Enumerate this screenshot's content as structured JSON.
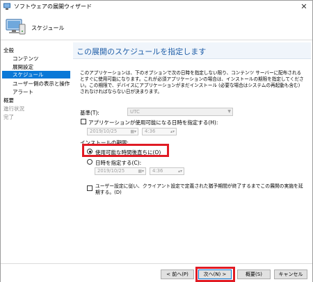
{
  "window": {
    "title": "ソフトウェアの展開ウィザード",
    "close_glyph": "✕"
  },
  "header": {
    "title": "スケジュール"
  },
  "sidebar": {
    "items": [
      {
        "label": "全般",
        "level": 0,
        "state": "normal"
      },
      {
        "label": "コンテンツ",
        "level": 1,
        "state": "normal"
      },
      {
        "label": "展開設定",
        "level": 1,
        "state": "normal"
      },
      {
        "label": "スケジュール",
        "level": 1,
        "state": "selected"
      },
      {
        "label": "ユーザー側の表示と操作",
        "level": 1,
        "state": "normal"
      },
      {
        "label": "アラート",
        "level": 1,
        "state": "normal"
      },
      {
        "label": "概要",
        "level": 0,
        "state": "normal"
      },
      {
        "label": "進行状況",
        "level": 0,
        "state": "disabled"
      },
      {
        "label": "完了",
        "level": 0,
        "state": "disabled"
      }
    ]
  },
  "main": {
    "title": "この展開のスケジュールを指定します",
    "description": "このアプリケーションは、下のオプションで次の日時を指定しない限り、コンテンツ サーバーに配布されるとすぐに使用可能になります。これが必須アプリケーションの場合は、インストールの期限を指定してください。この期限で、デバイスにアプリケーションがまだインストール (必要な場合はシステムの再起動も含む) されなければならない日が決まります。",
    "basis_label": "基準(T):",
    "basis_value": "UTC",
    "available_checkbox_label": "アプリケーションが使用可能になる日時を指定する(H):",
    "available_date": "2019/10/25",
    "available_time": "4:36",
    "deadline_label": "インストールの期限:",
    "radio_asap_label": "使用可能な時間後直ちに(O)",
    "radio_specify_label": "日時を指定する(C):",
    "deadline_date": "2019/10/25",
    "deadline_time": "4:36",
    "delay_checkbox_label": "ユーザー設定に従い、クライアント設定で定義された猶予期間が終了するまでこの展開の実施を延期する。(D)"
  },
  "footer": {
    "back_label": "< 前へ(P)",
    "next_label": "次へ(N) >",
    "summary_label": "概要(S)",
    "cancel_label": "キャンセル"
  },
  "colors": {
    "accent": "#0a78d7",
    "highlight": "#e01b24",
    "title_blue": "#1f5ea8"
  }
}
